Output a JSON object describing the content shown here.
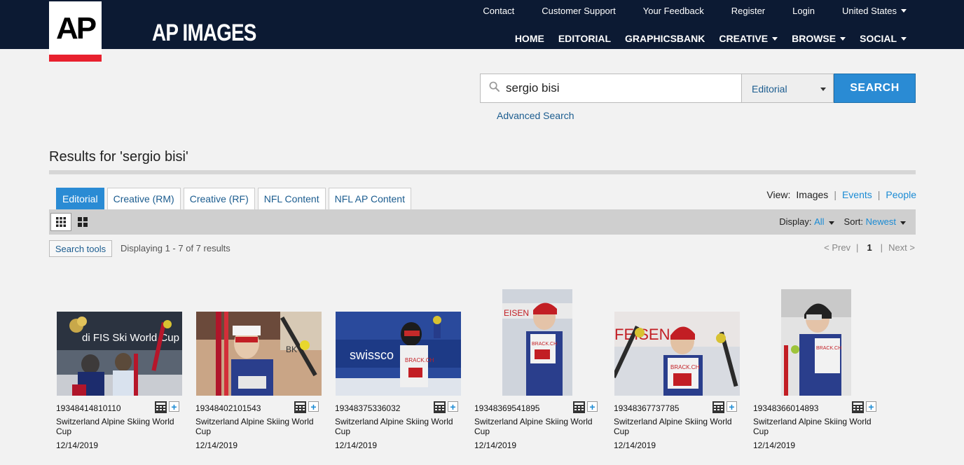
{
  "logo": {
    "text": "AP"
  },
  "site_title": "AP IMAGES",
  "util_nav": [
    "Contact",
    "Customer Support",
    "Your Feedback",
    "Register",
    "Login",
    "United States"
  ],
  "main_nav": [
    "HOME",
    "EDITORIAL",
    "GRAPHICSBANK",
    "CREATIVE",
    "BROWSE",
    "SOCIAL"
  ],
  "search": {
    "query": "sergio bisi",
    "collection": "Editorial",
    "button": "SEARCH",
    "advanced": "Advanced Search"
  },
  "results_heading": "Results for 'sergio bisi'",
  "tabs": [
    "Editorial",
    "Creative (RM)",
    "Creative (RF)",
    "NFL Content",
    "NFL AP Content"
  ],
  "view": {
    "label": "View:",
    "current": "Images",
    "events": "Events",
    "people": "People",
    "sep": "|"
  },
  "toolbar": {
    "display_label": "Display:",
    "display_value": "All",
    "sort_label": "Sort:",
    "sort_value": "Newest"
  },
  "search_tools": "Search tools",
  "displaying": "Displaying 1 - 7  of  7 results",
  "pager": {
    "prev": "< Prev",
    "sep": "|",
    "current": "1",
    "next": "Next >"
  },
  "results": [
    {
      "id": "19348414810110",
      "title": "Switzerland Alpine Skiing World Cup",
      "date": "12/14/2019"
    },
    {
      "id": "19348402101543",
      "title": "Switzerland Alpine Skiing World Cup",
      "date": "12/14/2019"
    },
    {
      "id": "19348375336032",
      "title": "Switzerland Alpine Skiing World Cup",
      "date": "12/14/2019"
    },
    {
      "id": "19348369541895",
      "title": "Switzerland Alpine Skiing World Cup",
      "date": "12/14/2019"
    },
    {
      "id": "19348367737785",
      "title": "Switzerland Alpine Skiing World Cup",
      "date": "12/14/2019"
    },
    {
      "id": "19348366014893",
      "title": "Switzerland Alpine Skiing World Cup",
      "date": "12/14/2019"
    }
  ],
  "photo_texts": {
    "p1": "di FIS Ski World Cup",
    "p2": "BK",
    "p3": "swissco",
    "p3b": "BRACK.CH",
    "p4": "EISEN",
    "p4b": "BRACK.CH",
    "p5": "FEISEN",
    "p5b": "BRACK.CH",
    "p6": "BRACK.CH"
  },
  "colors": {
    "header": "#0c1a33",
    "accent_red": "#e8212e",
    "link": "#1b5c8f",
    "primary": "#2a8bd4"
  }
}
